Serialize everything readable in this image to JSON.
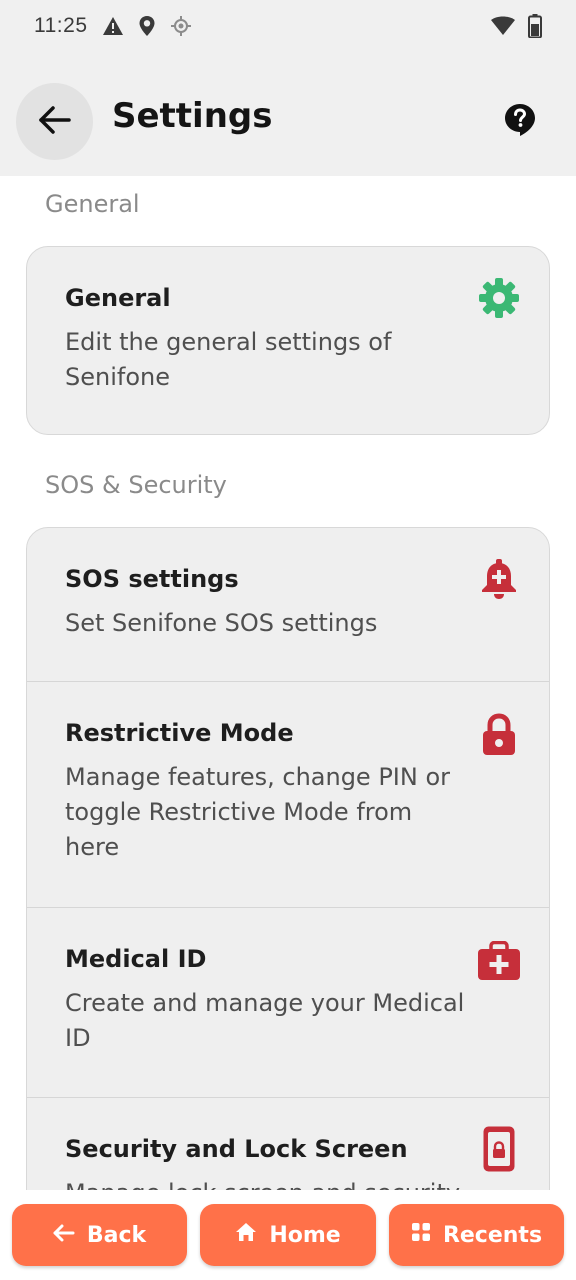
{
  "status_bar": {
    "time": "11:25",
    "icons": [
      "alert-triangle-icon",
      "location-pin-icon",
      "gps-icon",
      "wifi-icon",
      "battery-icon"
    ]
  },
  "header": {
    "title": "Settings",
    "back_icon": "arrow-left-icon",
    "help_icon": "help-icon"
  },
  "sections": [
    {
      "heading": "General",
      "items": [
        {
          "title": "General",
          "description": "Edit the general settings of Senifone",
          "icon": "gear-icon",
          "icon_color": "#3bb874"
        }
      ]
    },
    {
      "heading": "SOS & Security",
      "items": [
        {
          "title": "SOS settings",
          "description": "Set Senifone SOS settings",
          "icon": "bell-plus-icon",
          "icon_color": "#c62f3a"
        },
        {
          "title": "Restrictive Mode",
          "description": "Manage features, change PIN or toggle Restrictive Mode from here",
          "icon": "lock-icon",
          "icon_color": "#c62f3a"
        },
        {
          "title": "Medical ID",
          "description": "Create and manage your Medical ID",
          "icon": "medical-kit-icon",
          "icon_color": "#c62f3a"
        },
        {
          "title": "Security and Lock Screen",
          "description": "Manage lock screen and security",
          "icon": "phone-lock-icon",
          "icon_color": "#c62f3a"
        }
      ]
    }
  ],
  "bottom_nav": {
    "back_label": "Back",
    "home_label": "Home",
    "recents_label": "Recents",
    "accent": "#ff7149"
  }
}
